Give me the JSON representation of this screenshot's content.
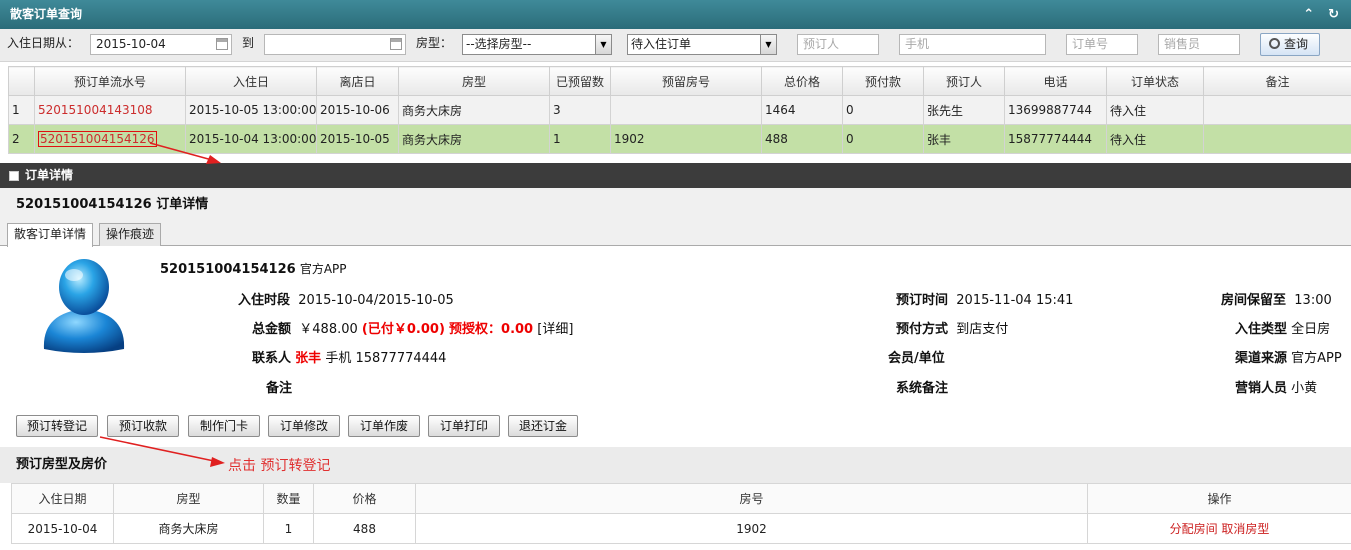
{
  "window": {
    "title": "散客订单查询"
  },
  "search": {
    "checkin_from_label": "入住日期从：",
    "checkin_from": "2015-10-04",
    "to_label": "到",
    "room_type_label": "房型：",
    "room_type": "--选择房型--",
    "order_filter": "待入住订单",
    "booker_ph": "预订人",
    "phone_ph": "手机",
    "order_no_ph": "订单号",
    "sales_ph": "销售员",
    "query_label": "查询"
  },
  "orders": {
    "headers": [
      "预订单流水号",
      "入住日",
      "离店日",
      "房型",
      "已预留数",
      "预留房号",
      "总价格",
      "预付款",
      "预订人",
      "电话",
      "订单状态",
      "备注"
    ],
    "rows": [
      [
        "1",
        "520151004143108",
        "2015-10-05 13:00:00",
        "2015-10-06",
        "商务大床房",
        "3",
        "",
        "1464",
        "0",
        "张先生",
        "13699887744",
        "待入住",
        ""
      ],
      [
        "2",
        "520151004154126",
        "2015-10-04 13:00:00",
        "2015-10-05",
        "商务大床房",
        "1",
        "1902",
        "488",
        "0",
        "张丰",
        "15877774444",
        "待入住",
        ""
      ]
    ]
  },
  "detail": {
    "bar_title": "订单详情",
    "heading": "520151004154126 订单详情",
    "tabs": [
      "散客订单详情",
      "操作痕迹"
    ],
    "order_no": "520151004154126",
    "source_tag": "官方APP",
    "stay_label": "入住时段",
    "stay": "2015-10-04/2015-10-05",
    "total_label": "总金额",
    "total": "￥488.00",
    "paid": "(已付￥0.00)",
    "preauth": "预授权：0.00",
    "detail_link": "[详细]",
    "contact_label": "联系人",
    "contact_name": "张丰",
    "mobile_label": "手机",
    "mobile": "15877774444",
    "remark_label": "备注",
    "booked_at_label": "预订时间",
    "booked_at": "2015-11-04 15:41",
    "pay_method_label": "预付方式",
    "pay_method": "到店支付",
    "member_label": "会员/单位",
    "sys_remark_label": "系统备注",
    "hold_until_label": "房间保留至",
    "hold_until": "13:00",
    "checkin_type_label": "入住类型",
    "checkin_type": "全日房",
    "channel_label": "渠道来源",
    "channel": "官方APP",
    "sales_label": "营销人员",
    "sales": "小黄"
  },
  "actions": [
    "预订转登记",
    "预订收款",
    "制作门卡",
    "订单修改",
    "订单作废",
    "订单打印",
    "退还订金"
  ],
  "section2": {
    "title": "预订房型及房价",
    "annotation": "点击 预订转登记",
    "headers": [
      "入住日期",
      "房型",
      "数量",
      "价格",
      "房号",
      "操作"
    ],
    "row": {
      "date": "2015-10-04",
      "room_type": "商务大床房",
      "qty": "1",
      "price": "488",
      "room_no": "1902",
      "op_assign": "分配房间",
      "op_cancel": "取消房型"
    }
  },
  "colors": {
    "title_bar": "#2f7282",
    "selected_row": "#c3e0a6",
    "annotation_red": "#e03030"
  }
}
